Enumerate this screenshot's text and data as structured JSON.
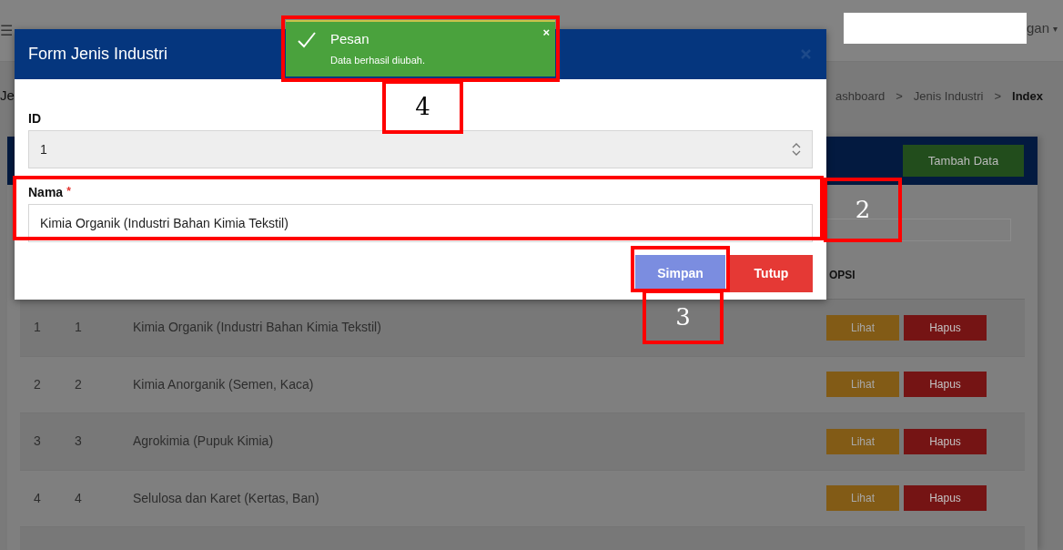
{
  "navbar": {
    "menu_glyph": "☰",
    "user_menu": "gan",
    "caret": "▾"
  },
  "page": {
    "title": "Je",
    "breadcrumb": [
      {
        "label": "ashboard",
        "current": false
      },
      {
        "label": "Jenis Industri",
        "current": false
      },
      {
        "label": "Index",
        "current": true
      }
    ],
    "separator": ">"
  },
  "card": {
    "add_button": "Tambah Data",
    "options_header": "OPSI",
    "rows": [
      {
        "no": "1",
        "id": "1",
        "nama": "Kimia Organik (Industri Bahan Kimia Tekstil)",
        "view": "Lihat",
        "delete": "Hapus"
      },
      {
        "no": "2",
        "id": "2",
        "nama": "Kimia Anorganik (Semen, Kaca)",
        "view": "Lihat",
        "delete": "Hapus"
      },
      {
        "no": "3",
        "id": "3",
        "nama": "Agrokimia (Pupuk Kimia)",
        "view": "Lihat",
        "delete": "Hapus"
      },
      {
        "no": "4",
        "id": "4",
        "nama": "Selulosa dan Karet (Kertas, Ban)",
        "view": "Lihat",
        "delete": "Hapus"
      }
    ]
  },
  "modal": {
    "title": "Form Jenis Industri",
    "fields": [
      {
        "label": "ID",
        "value": "1",
        "kind": "number"
      },
      {
        "label": "Nama",
        "value": "Kimia Organik (Industri Bahan Kimia Tekstil)",
        "required_mark": "*",
        "kind": "text"
      }
    ],
    "buttons": [
      "Simpan",
      "Tutup"
    ]
  },
  "toast": {
    "title": "Pesan",
    "message": "Data berhasil diubah.",
    "close": "×"
  },
  "annotations": [
    {
      "label": "2"
    },
    {
      "label": "3"
    },
    {
      "label": "4"
    }
  ]
}
